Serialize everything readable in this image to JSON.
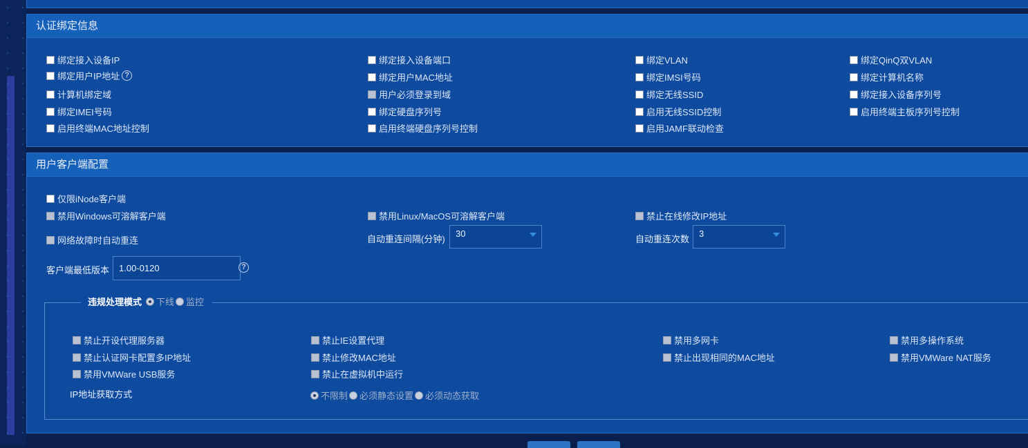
{
  "bind_section": {
    "title": "认证绑定信息",
    "items": [
      {
        "label": "绑定接入设备IP"
      },
      {
        "label": "绑定接入设备端口"
      },
      {
        "label": "绑定VLAN"
      },
      {
        "label": "绑定QinQ双VLAN"
      },
      {
        "label": "绑定用户IP地址"
      },
      {
        "label": "绑定用户MAC地址"
      },
      {
        "label": "绑定IMSI号码"
      },
      {
        "label": "绑定计算机名称"
      },
      {
        "label": "计算机绑定域"
      },
      {
        "label": "用户必须登录到域"
      },
      {
        "label": "绑定无线SSID"
      },
      {
        "label": "绑定接入设备序列号"
      },
      {
        "label": "绑定IMEI号码"
      },
      {
        "label": "绑定硬盘序列号"
      },
      {
        "label": "启用无线SSID控制"
      },
      {
        "label": "启用终端主板序列号控制"
      },
      {
        "label": "启用终端MAC地址控制"
      },
      {
        "label": "启用终端硬盘序列号控制"
      },
      {
        "label": "启用JAMF联动检查"
      }
    ]
  },
  "client_section": {
    "title": "用户客户端配置",
    "inode_only": "仅限iNode客户端",
    "disable_windows": "禁用Windows可溶解客户端",
    "disable_linux": "禁用Linux/MacOS可溶解客户端",
    "forbid_ip_change": "禁止在线修改IP地址",
    "auto_reconnect": "网络故障时自动重连",
    "reconnect_interval_label": "自动重连间隔(分钟)",
    "reconnect_interval_value": "30",
    "reconnect_count_label": "自动重连次数",
    "reconnect_count_value": "3",
    "min_version_label": "客户端最低版本",
    "min_version_value": "1.00-0120",
    "violation": {
      "title": "违规处理模式",
      "mode_offline": "下线",
      "mode_monitor": "监控",
      "items": [
        {
          "label": "禁止开设代理服务器"
        },
        {
          "label": "禁止IE设置代理"
        },
        {
          "label": "禁用多网卡"
        },
        {
          "label": "禁用多操作系统"
        },
        {
          "label": "禁止认证网卡配置多IP地址"
        },
        {
          "label": "禁止修改MAC地址"
        },
        {
          "label": "禁止出现相同的MAC地址"
        },
        {
          "label": "禁用VMWare NAT服务"
        },
        {
          "label": "禁用VMWare USB服务"
        },
        {
          "label": "禁止在虚拟机中运行"
        }
      ],
      "ip_method_label": "IP地址获取方式",
      "ip_unlimited": "不限制",
      "ip_static": "必须静态设置",
      "ip_dynamic": "必须动态获取"
    }
  },
  "help_icon_char": "?"
}
